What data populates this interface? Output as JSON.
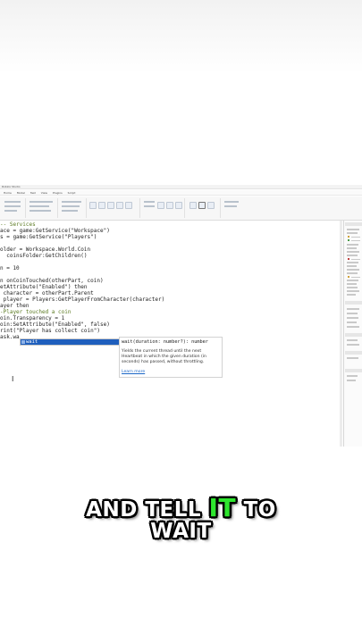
{
  "window": {
    "title": "Roblox Studio"
  },
  "menu": [
    "Home",
    "Model",
    "Test",
    "View",
    "Plugins",
    "Script"
  ],
  "code_lines": [
    {
      "cls": "cm",
      "text": "-- Services"
    },
    {
      "cls": "",
      "text": "ace = game:GetService(\"Workspace\")"
    },
    {
      "cls": "",
      "text": "s = game:GetService(\"Players\")"
    },
    {
      "cls": "",
      "text": ""
    },
    {
      "cls": "",
      "text": "older = Workspace.World.Coin"
    },
    {
      "cls": "",
      "text": "  coinsFolder:GetChildren()"
    },
    {
      "cls": "",
      "text": ""
    },
    {
      "cls": "",
      "text": "n = 10"
    },
    {
      "cls": "",
      "text": ""
    },
    {
      "cls": "",
      "text": "n onCoinTouched(otherPart, coin)"
    },
    {
      "cls": "",
      "text": "etAttribute(\"Enabled\") then"
    },
    {
      "cls": "",
      "text": " character = otherPart.Parent"
    },
    {
      "cls": "",
      "text": " player = Players:GetPlayerFromCharacter(character)"
    },
    {
      "cls": "",
      "text": "ayer then"
    },
    {
      "cls": "cm",
      "text": "-Player touched a coin"
    },
    {
      "cls": "",
      "text": "oin.Transparency = 1"
    },
    {
      "cls": "",
      "text": "oin:SetAttribute(\"Enabled\", false)"
    },
    {
      "cls": "",
      "text": "rint(\"Player has collect coin\")"
    },
    {
      "cls": "",
      "text": "ask.wa"
    }
  ],
  "autocomplete": {
    "item": "wait"
  },
  "doc": {
    "signature": "wait(duration: number?): number",
    "description": "Yields the current thread until the next Heartbeat in which the given duration (in seconds) has passed, without throttling.",
    "link": "Learn more"
  },
  "caption": {
    "line1_a": "AND TELL ",
    "line1_highlight": "IT",
    "line1_b": " TO",
    "line2": "WAIT"
  },
  "colors": {
    "highlight": "#2ee62e",
    "autocomplete_selected": "#1f5fbd"
  }
}
